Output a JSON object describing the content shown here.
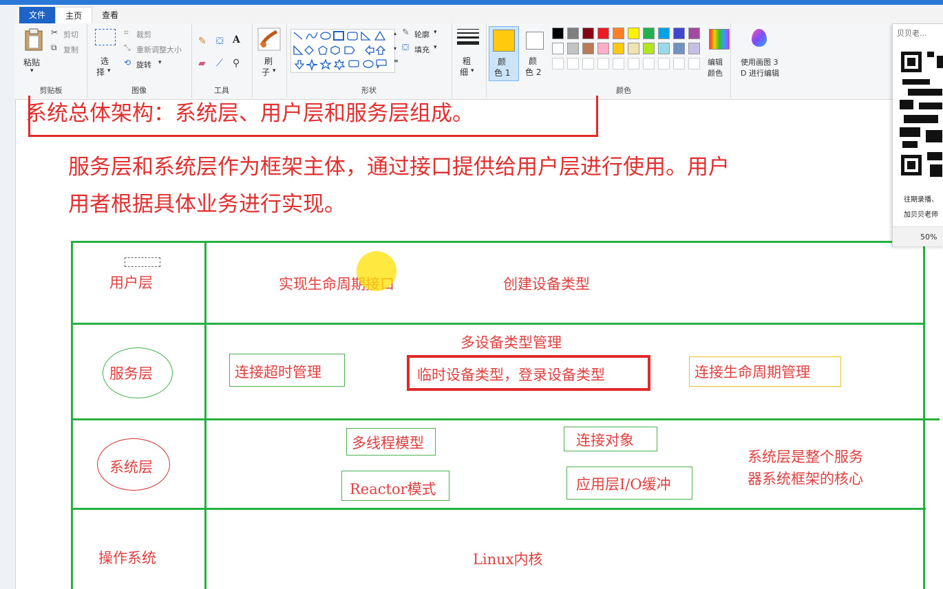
{
  "tabs": {
    "file": "文件",
    "home": "主页",
    "view": "查看"
  },
  "ribbon": {
    "clipboard": {
      "paste": "粘贴",
      "cut": "剪切",
      "copy": "复制",
      "group": "剪贴板"
    },
    "image": {
      "select1": "选",
      "select2": "择",
      "crop": "裁剪",
      "resize": "重新调整大小",
      "rotate": "旋转",
      "group": "图像"
    },
    "tools": {
      "group": "工具"
    },
    "brush": {
      "l1": "刷",
      "l2": "子"
    },
    "shapes": {
      "outline": "轮廓",
      "fill": "填充",
      "group": "形状"
    },
    "size": {
      "l1": "粗",
      "l2": "细"
    },
    "color1": {
      "l1": "颜",
      "l2": "色 1"
    },
    "color2": {
      "l1": "颜",
      "l2": "色 2"
    },
    "edit_colors": {
      "l1": "编辑",
      "l2": "颜色"
    },
    "paint3d": {
      "l1": "使用画图 3",
      "l2": "D 进行编辑"
    },
    "colors_group": "颜色",
    "palette_row1": [
      "#000000",
      "#7f7f7f",
      "#880015",
      "#ed1c24",
      "#ff7f27",
      "#fff200",
      "#22b14c",
      "#00a2e8",
      "#3f48cc",
      "#a349a4"
    ],
    "palette_row2": [
      "#ffffff",
      "#c3c3c3",
      "#b97a57",
      "#ffaec9",
      "#ffc90e",
      "#efe4b0",
      "#b5e61d",
      "#99d9ea",
      "#7092be",
      "#c8bfe7"
    ],
    "color1_value": "#ffc90e"
  },
  "qr_panel": {
    "title": "贝贝老...",
    "line1": "往期录播、",
    "line2": "加贝贝老师",
    "zoom": "50%"
  },
  "canvas": {
    "title": "系统总体架构：系统层、用户层和服务层组成。",
    "desc1": "服务层和系统层作为框架主体，通过接口提供给用户层进行使用。用户",
    "desc2": "用者根据具体业务进行实现。",
    "layers": {
      "user": "用户层",
      "service": "服务层",
      "system": "系统层",
      "os": "操作系统"
    },
    "user_row": {
      "a": "实现生命周期接口",
      "b": "创建设备类型"
    },
    "service_row": {
      "title": "多设备类型管理",
      "a": "连接超时管理",
      "b": "临时设备类型，登录设备类型",
      "c": "连接生命周期管理"
    },
    "system_row": {
      "a": "多线程模型",
      "b": "连接对象",
      "c": "Reactor模式",
      "d": "应用层I/O缓冲",
      "note1": "系统层是整个服务",
      "note2": "器系统框架的核心"
    },
    "os_row": {
      "a": "Linux内核"
    }
  }
}
